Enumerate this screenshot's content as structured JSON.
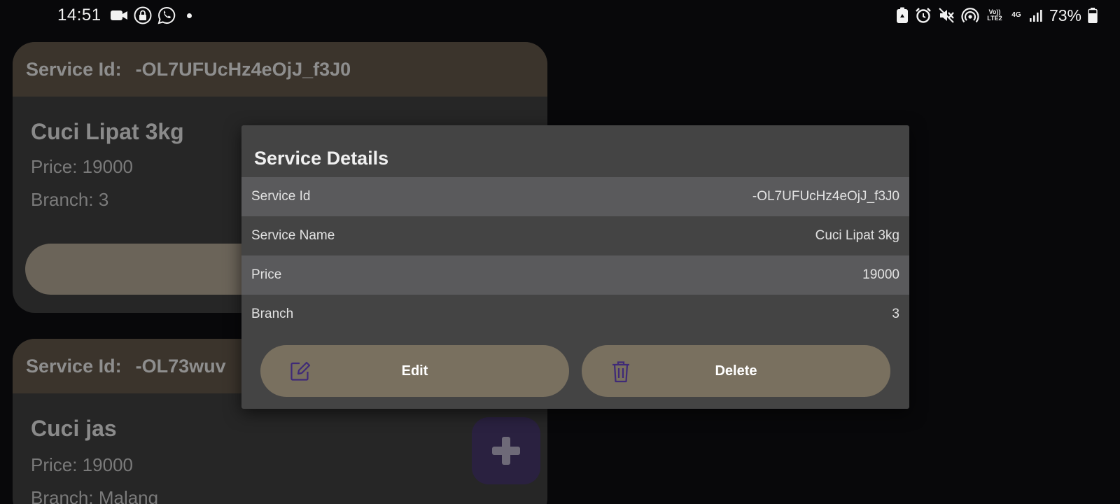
{
  "status_bar": {
    "time": "14:51",
    "left_icons": [
      "video-camera-icon",
      "lock-icon",
      "whatsapp-icon",
      "notification-dot-icon"
    ],
    "right_icons": [
      "recycle-battery-icon",
      "alarm-icon",
      "mute-icon",
      "hotspot-icon",
      "volte-icon",
      "4g-icon",
      "signal-icon",
      "battery-icon"
    ],
    "volte_label": "Vo)) LTE2",
    "network_label": "4G",
    "battery_percent": "73%"
  },
  "services": [
    {
      "id_label": "Service Id:",
      "id_value": "-OL7UFUcHz4eOjJ_f3J0",
      "name": "Cuci Lipat 3kg",
      "price_line": "Price: 19000",
      "branch_line": "Branch: 3"
    },
    {
      "id_label": "Service Id:",
      "id_value": "-OL73wuv",
      "name": "Cuci jas",
      "price_line": "Price: 19000",
      "branch_line": "Branch: Malang"
    }
  ],
  "fab": {
    "icon": "plus-icon"
  },
  "dialog": {
    "title": "Service Details",
    "rows": [
      {
        "label": "Service Id",
        "value": "-OL7UFUcHz4eOjJ_f3J0"
      },
      {
        "label": "Service Name",
        "value": "Cuci Lipat 3kg"
      },
      {
        "label": "Price",
        "value": "19000"
      },
      {
        "label": "Branch",
        "value": "3"
      }
    ],
    "edit_label": "Edit",
    "delete_label": "Delete",
    "icon_color": "#3f2a77"
  },
  "colors": {
    "background": "#08080a",
    "card": "#262626",
    "card_header": "#3b342c",
    "dialog": "#444444",
    "button": "#79705f",
    "fab": "#2a2140"
  }
}
